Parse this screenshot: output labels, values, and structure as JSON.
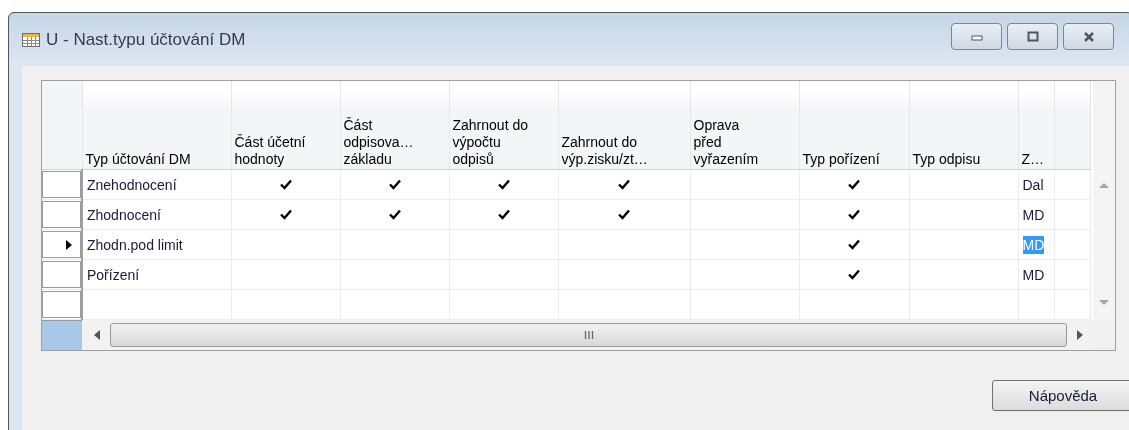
{
  "window": {
    "title": "U - Nast.typu účtování DM"
  },
  "table": {
    "columns": [
      "Typ účtování DM",
      "Část účetní\nhodnoty",
      "Část\nodpisova…\nzákladu",
      "Zahrnout do\nvýpočtu\nodpisů",
      "Zahrnout do\nvýp.zisku/zt…",
      "Oprava\npřed\nvyřazením",
      "Typ pořízení",
      "Typ odpisu",
      "Z…"
    ],
    "rows": [
      {
        "type": "Znehodnocení",
        "flags": [
          true,
          true,
          true,
          true,
          false,
          true,
          false
        ],
        "value": "Dal",
        "selected": false
      },
      {
        "type": "Zhodnocení",
        "flags": [
          true,
          true,
          true,
          true,
          false,
          true,
          false
        ],
        "value": "MD",
        "selected": false
      },
      {
        "type": "Zhodn.pod limit",
        "flags": [
          false,
          false,
          false,
          false,
          false,
          true,
          false
        ],
        "value": "MD",
        "selected": true
      },
      {
        "type": "Pořízení",
        "flags": [
          false,
          false,
          false,
          false,
          false,
          true,
          false
        ],
        "value": "MD",
        "selected": false
      }
    ]
  },
  "buttons": [
    "Nápověda"
  ]
}
